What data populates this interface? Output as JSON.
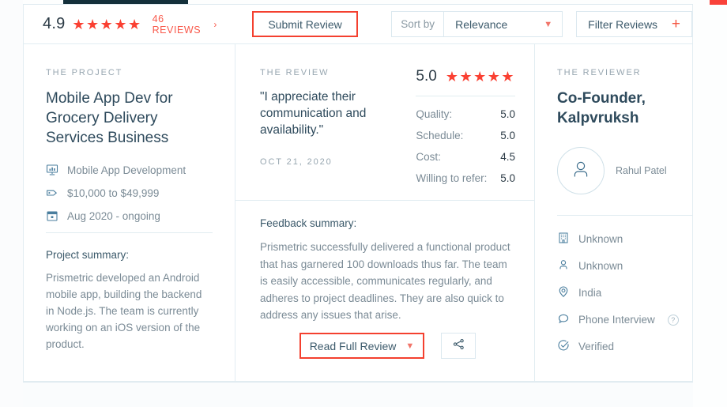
{
  "header": {
    "rating_score": "4.9",
    "stars": "★★★★★",
    "reviews_link": "46 REVIEWS",
    "reviews_chevron": "chevron-right-icon",
    "submit_label": "Submit Review",
    "sort_label": "Sort by",
    "sort_value": "Relevance",
    "sort_caret": "chevron-down-icon",
    "filter_label": "Filter Reviews",
    "filter_plus": "plus-icon"
  },
  "project": {
    "eyebrow": "THE PROJECT",
    "title": "Mobile App Dev for Grocery Delivery Services Business",
    "meta": [
      {
        "icon": "presentation-chart-icon",
        "label": "Mobile App Development"
      },
      {
        "icon": "price-tag-icon",
        "label": "$10,000 to $49,999"
      },
      {
        "icon": "calendar-icon",
        "label": "Aug 2020 - ongoing"
      }
    ],
    "summary_label": "Project summary:",
    "summary_text": "Prismetric developed an Android mobile app, building the backend in Node.js. The team is currently working on an iOS version of the product."
  },
  "review": {
    "eyebrow": "THE REVIEW",
    "quote": "\"I appreciate their communication and availability.\"",
    "date": "OCT 21, 2020",
    "score": "5.0",
    "stars": "★★★★★",
    "metrics": [
      {
        "label": "Quality:",
        "value": "5.0"
      },
      {
        "label": "Schedule:",
        "value": "5.0"
      },
      {
        "label": "Cost:",
        "value": "4.5"
      },
      {
        "label": "Willing to refer:",
        "value": "5.0"
      }
    ],
    "feedback_label": "Feedback summary:",
    "feedback_text": "Prismetric successfully delivered a functional product that has garnered 100 downloads thus far. The team is easily accessible, communicates regularly, and adheres to project deadlines. They are also quick to address any issues that arise.",
    "read_full_label": "Read Full Review",
    "read_full_caret": "chevron-down-icon",
    "share_icon": "share-icon"
  },
  "reviewer": {
    "eyebrow": "THE REVIEWER",
    "title": "Co-Founder, Kalpvruksh",
    "avatar_icon": "person-avatar-icon",
    "name": "Rahul Patel",
    "details": [
      {
        "icon": "building-icon",
        "label": "Unknown"
      },
      {
        "icon": "person-icon",
        "label": "Unknown"
      },
      {
        "icon": "location-pin-icon",
        "label": "India"
      },
      {
        "icon": "chat-bubble-icon",
        "label": "Phone Interview",
        "help": "?"
      },
      {
        "icon": "verified-check-icon",
        "label": "Verified"
      }
    ]
  },
  "colors": {
    "accent_red": "#f4402f",
    "star_red": "#fa4032",
    "text_dark": "#2e4a5c",
    "text_muted": "#7b8b96",
    "border": "#e2edf2",
    "topbar_dark": "#14303b"
  }
}
